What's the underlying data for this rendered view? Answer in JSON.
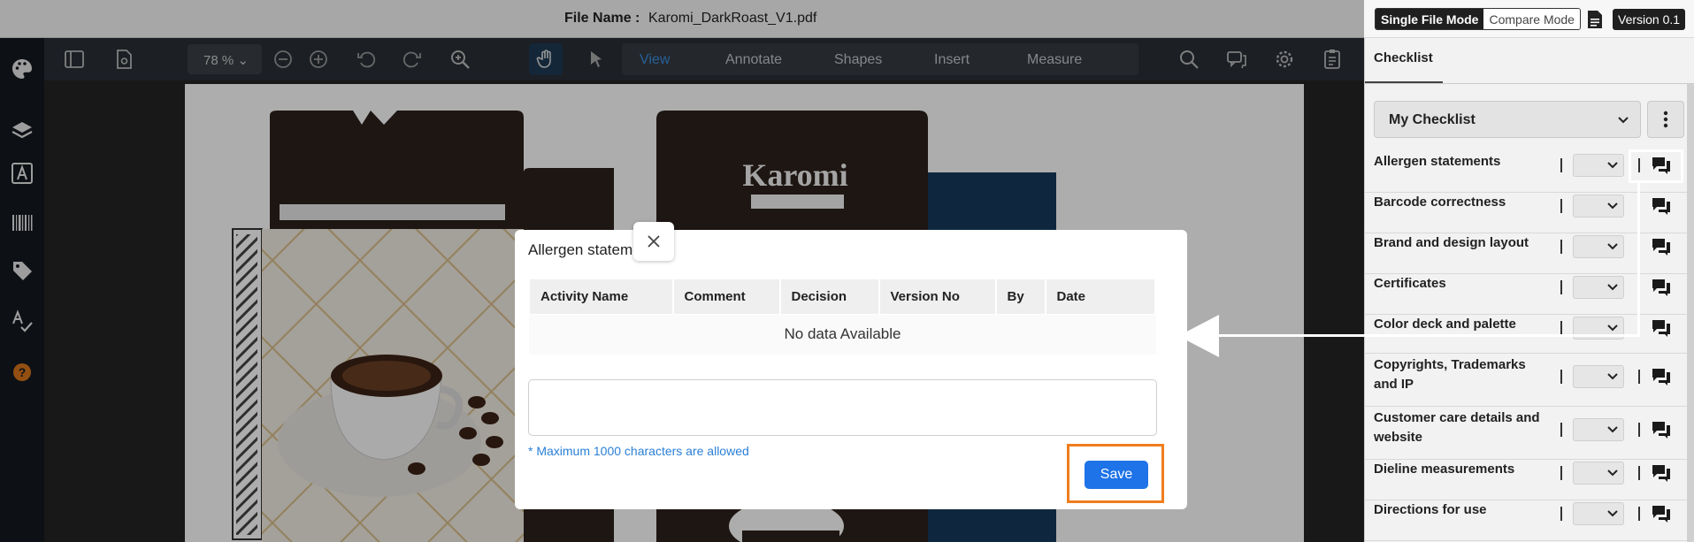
{
  "topbar": {
    "file_label": "File Name :",
    "file_name": "Karomi_DarkRoast_V1.pdf",
    "single_mode": "Single File Mode",
    "compare_mode": "Compare Mode",
    "version": "Version 0.1"
  },
  "toolbar": {
    "zoom": "78 %",
    "tabs": [
      "View",
      "Annotate",
      "Shapes",
      "Insert",
      "Measure"
    ],
    "active_tab": "View"
  },
  "panel": {
    "tab": "Checklist",
    "checklist_name": "My Checklist",
    "items": [
      {
        "label": "Allergen statements"
      },
      {
        "label": "Barcode correctness"
      },
      {
        "label": "Brand and design layout"
      },
      {
        "label": "Certificates"
      },
      {
        "label": "Color deck and palette"
      },
      {
        "label": "Copyrights, Trademarks and IP"
      },
      {
        "label": "Customer care details and website"
      },
      {
        "label": "Dieline measurements"
      },
      {
        "label": "Directions for use"
      }
    ]
  },
  "modal": {
    "title": "Allergen statements",
    "columns": [
      "Activity Name",
      "Comment",
      "Decision",
      "Version No",
      "By",
      "Date"
    ],
    "empty_text": "No data Available",
    "comment_value": "",
    "hint": "* Maximum 1000 characters are allowed",
    "save_label": "Save"
  },
  "colors": {
    "accent": "#1e73e8",
    "highlight": "#f07d1e",
    "toolbar": "#2a2f35",
    "sidebar": "#14191f"
  }
}
